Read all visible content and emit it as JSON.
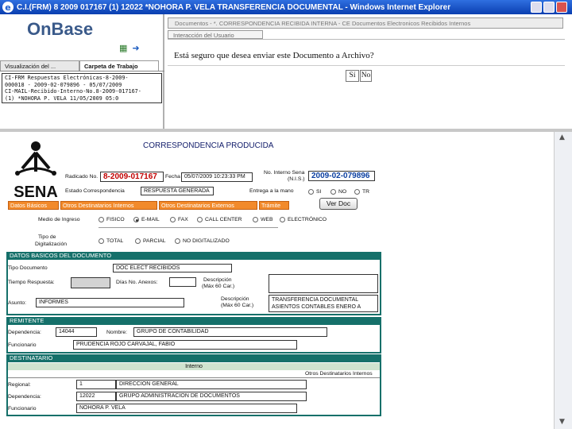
{
  "window": {
    "title": "C.I.(FRM) 8 2009 017167 (1) 12022 *NOHORA P. VELA  TRANSFERENCIA DOCUMENTAL  - Windows Internet Explorer"
  },
  "left_pane": {
    "logo": "OnBase",
    "tabs": [
      "Visualización del ...",
      "Carpeta de Trabajo"
    ],
    "list_lines": [
      "CI-FRM Respuestas Electrónicas-8-2009-",
      "000018 - 2009-02-079896 - 05/07/2009",
      "CI-MAIL-Recibido-Interno-No.8-2009-017167-",
      "(1) *NOHORA P. VELA 11/05/2009 05:0"
    ]
  },
  "dialog": {
    "doc_tab": "Documentos - *. CORRESPONDENCIA RECIBIDA INTERNA - CE Documentos Electronicos Recibidos Internos",
    "tab_label": "Interacción del Usuario",
    "question": "Está seguro que desea enviar este Documento a Archivo?",
    "yes_label": "Sí",
    "no_label": "No"
  },
  "form": {
    "org_name": "SENA",
    "title": "CORRESPONDENCIA PRODUCIDA",
    "radicado_label": "Radicado No.",
    "radicado_value": "8-2009-017167",
    "fecha_label": "Fecha",
    "fecha_value": "05/07/2009 10:23:33 PM",
    "interno_label_1": "No. Interno Sena",
    "interno_label_2": "(N.I.S.)",
    "interno_value": "2009-02-079896",
    "estado_label": "Estado Correspondencia",
    "estado_value": "RESPUESTA GENERADA",
    "entrega_label": "Entrega a la mano",
    "entrega_options": [
      "SI",
      "NO",
      "TR"
    ],
    "tabs": [
      "Datos Básicos",
      "Otros Destinatarios Internos",
      "Otros Destinatarios Externos",
      "Trámite"
    ],
    "verdoc_label": "Ver Doc",
    "medio_label": "Medio de Ingreso",
    "medio_options": [
      "FISICO",
      "E-MAIL",
      "FAX",
      "CALL CENTER",
      "WEB",
      "ELECTRÓNICO"
    ],
    "tipo_dig_label_1": "Tipo de",
    "tipo_dig_label_2": "Digitalización",
    "tipo_dig_options": [
      "TOTAL",
      "PARCIAL",
      "NO DIGITALIZADO"
    ],
    "datos_basicos": {
      "header": "DATOS BASICOS DEL DOCUMENTO",
      "tipo_doc_label": "Tipo Documento",
      "tipo_doc_value": "DOC ELECT RECIBIDOS",
      "tiempo_label": "Tiempo Respuesta:",
      "dias_label": "Días No. Anexos:",
      "desc_anexos_label_1": "Descripción",
      "desc_anexos_label_2": "(Máx 60 Car.)",
      "asunto_label": "Asunto:",
      "asunto_value": "INFORMES",
      "descripcion_label_1": "Descripción",
      "descripcion_label_2": "(Máx 60 Car.)",
      "descripcion_value_1": "TRANSFERENCIA DOCUMENTAL",
      "descripcion_value_2": "ASIENTOS CONTABLES ENERO A"
    },
    "remitente": {
      "header": "REMITENTE",
      "dependencia_label": "Dependencia:",
      "dependencia_code": "14044",
      "nombre_label": "Nombre:",
      "nombre_value": "GRUPO DE CONTABILIDAD",
      "funcionario_label": "Funcionario",
      "funcionario_value": "PRUDENCIA ROJO CARVAJAL, FABIO"
    },
    "destinatario": {
      "header": "DESTINATARIO",
      "subheader": "Interno",
      "otros_label": "Otros Destinatarios Internos",
      "regional_label": "Regional:",
      "regional_code": "1",
      "regional_value": "DIRECCION GENERAL",
      "dependencia_label": "Dependencia:",
      "dependencia_code": "12022",
      "dependencia_value": "GRUPO ADMINISTRACION DE DOCUMENTOS",
      "funcionario_label": "Funcionario",
      "funcionario_value": "NOHORA P. VELA"
    }
  },
  "colors": {
    "titlebar": "#0a3fb0",
    "orange_tab": "#f28a2b",
    "section_header": "#15706a",
    "radicado_red": "#c00000",
    "nis_blue": "#0b3fa0"
  }
}
